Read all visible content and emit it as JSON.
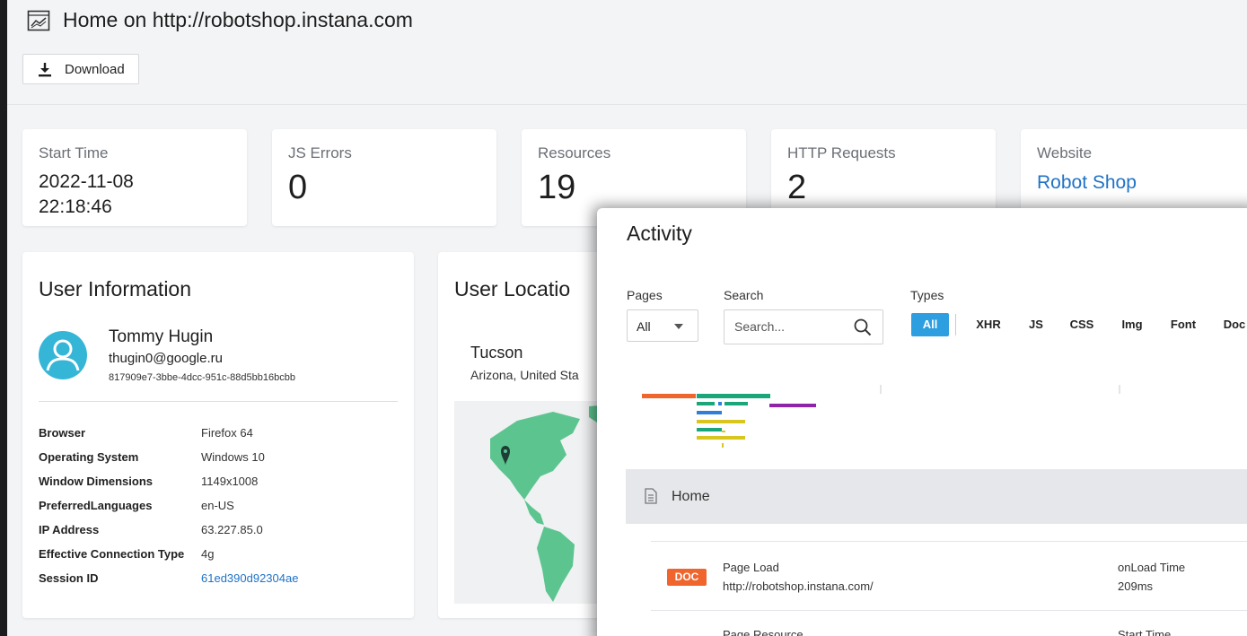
{
  "header": {
    "title": "Home on http://robotshop.instana.com",
    "download_label": "Download"
  },
  "stats": {
    "start_time": {
      "label": "Start Time",
      "date": "2022-11-08",
      "time": "22:18:46"
    },
    "js_errors": {
      "label": "JS Errors",
      "value": "0"
    },
    "resources": {
      "label": "Resources",
      "value": "19"
    },
    "http_requests": {
      "label": "HTTP Requests",
      "value": "2"
    },
    "website": {
      "label": "Website",
      "value": "Robot Shop"
    }
  },
  "user_info": {
    "title": "User Information",
    "name": "Tommy Hugin",
    "email": "thugin0@google.ru",
    "id": "817909e7-3bbe-4dcc-951c-88d5bb16bcbb",
    "rows": [
      {
        "key": "Browser",
        "value": "Firefox 64"
      },
      {
        "key": "Operating System",
        "value": "Windows 10"
      },
      {
        "key": "Window Dimensions",
        "value": "1149x1008"
      },
      {
        "key": "PreferredLanguages",
        "value": "en-US"
      },
      {
        "key": "IP Address",
        "value": "63.227.85.0"
      },
      {
        "key": "Effective Connection Type",
        "value": "4g"
      },
      {
        "key": "Session ID",
        "value": "61ed390d92304ae"
      }
    ]
  },
  "user_location": {
    "title": "User Locatio",
    "city": "Tucson",
    "region": "Arizona, United Sta"
  },
  "activity": {
    "title": "Activity",
    "pages_label": "Pages",
    "pages_value": "All",
    "search_label": "Search",
    "search_placeholder": "Search...",
    "types_label": "Types",
    "types": [
      "All",
      "XHR",
      "JS",
      "CSS",
      "Img",
      "Font",
      "Doc"
    ],
    "active_type": "All",
    "page_row": "Home",
    "events": [
      {
        "badge": "DOC",
        "badge_color": "#f0642d",
        "title": "Page Load",
        "subtitle": "http://robotshop.instana.com/",
        "metric_label": "onLoad Time",
        "metric_value": "209ms"
      },
      {
        "badge": "",
        "badge_color": "#e0bd22",
        "title": "Page Resource",
        "subtitle": "",
        "metric_label": "Start Time",
        "metric_value": ""
      }
    ]
  },
  "colors": {
    "accent": "#2d9ee0",
    "link": "#1f72c6",
    "doc": "#f0642d",
    "xhr_green": "#1aa57a",
    "js_yellow": "#d8c61e",
    "css_blue": "#2f7fd8",
    "purple": "#8e24aa",
    "map_land": "#5cc58f"
  },
  "icons": [
    "chart-icon",
    "download-icon",
    "user-avatar-icon",
    "location-pin-icon",
    "search-icon",
    "caret-down-icon",
    "document-icon"
  ]
}
